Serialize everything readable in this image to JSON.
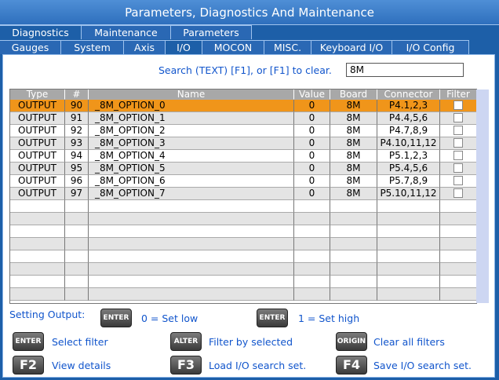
{
  "window": {
    "title": "Parameters, Diagnostics And Maintenance"
  },
  "tabs_main": [
    {
      "label": "Diagnostics",
      "active": true
    },
    {
      "label": "Maintenance",
      "active": false
    },
    {
      "label": "Parameters",
      "active": false
    }
  ],
  "tabs_sub": [
    {
      "label": "Gauges",
      "active": false
    },
    {
      "label": "System",
      "active": false
    },
    {
      "label": "Axis",
      "active": false
    },
    {
      "label": "I/O",
      "active": true
    },
    {
      "label": "MOCON",
      "active": false
    },
    {
      "label": "MISC.",
      "active": false
    },
    {
      "label": "Keyboard I/O",
      "active": false
    },
    {
      "label": "I/O Config",
      "active": false
    }
  ],
  "search": {
    "label": "Search (TEXT) [F1], or [F1] to clear.",
    "value": "8M"
  },
  "table": {
    "headers": [
      "Type",
      "#",
      "Name",
      "Value",
      "Board",
      "Connector",
      "Filter"
    ],
    "rows": [
      {
        "type": "OUTPUT",
        "num": "90",
        "name": "_8M_OPTION_0",
        "value": "0",
        "board": "8M",
        "connector": "P4.1,2,3",
        "selected": true
      },
      {
        "type": "OUTPUT",
        "num": "91",
        "name": "_8M_OPTION_1",
        "value": "0",
        "board": "8M",
        "connector": "P4.4,5,6",
        "selected": false
      },
      {
        "type": "OUTPUT",
        "num": "92",
        "name": "_8M_OPTION_2",
        "value": "0",
        "board": "8M",
        "connector": "P4.7,8,9",
        "selected": false
      },
      {
        "type": "OUTPUT",
        "num": "93",
        "name": "_8M_OPTION_3",
        "value": "0",
        "board": "8M",
        "connector": "P4.10,11,12",
        "selected": false
      },
      {
        "type": "OUTPUT",
        "num": "94",
        "name": "_8M_OPTION_4",
        "value": "0",
        "board": "8M",
        "connector": "P5.1,2,3",
        "selected": false
      },
      {
        "type": "OUTPUT",
        "num": "95",
        "name": "_8M_OPTION_5",
        "value": "0",
        "board": "8M",
        "connector": "P5.4,5,6",
        "selected": false
      },
      {
        "type": "OUTPUT",
        "num": "96",
        "name": "_8M_OPTION_6",
        "value": "0",
        "board": "8M",
        "connector": "P5.7,8,9",
        "selected": false
      },
      {
        "type": "OUTPUT",
        "num": "97",
        "name": "_8M_OPTION_7",
        "value": "0",
        "board": "8M",
        "connector": "P5.10,11,12",
        "selected": false
      }
    ],
    "empty_rows": 8
  },
  "legend": {
    "setting_output": "Setting Output:",
    "enter_key": "ENTER",
    "set_low": "0 = Set low",
    "set_high": "1 = Set high",
    "select_filter": "Select filter",
    "alter_key": "ALTER",
    "filter_by_selected": "Filter by selected",
    "origin_key": "ORIGIN",
    "clear_all_filters": "Clear all filters",
    "f2_key": "F2",
    "view_details": "View details",
    "f3_key": "F3",
    "load_io_search": "Load I/O search set.",
    "f4_key": "F4",
    "save_io_search": "Save I/O search set."
  },
  "colors": {
    "accent": "#1d5fa8",
    "selected_row": "#f0951a",
    "link_text": "#1155cc"
  }
}
